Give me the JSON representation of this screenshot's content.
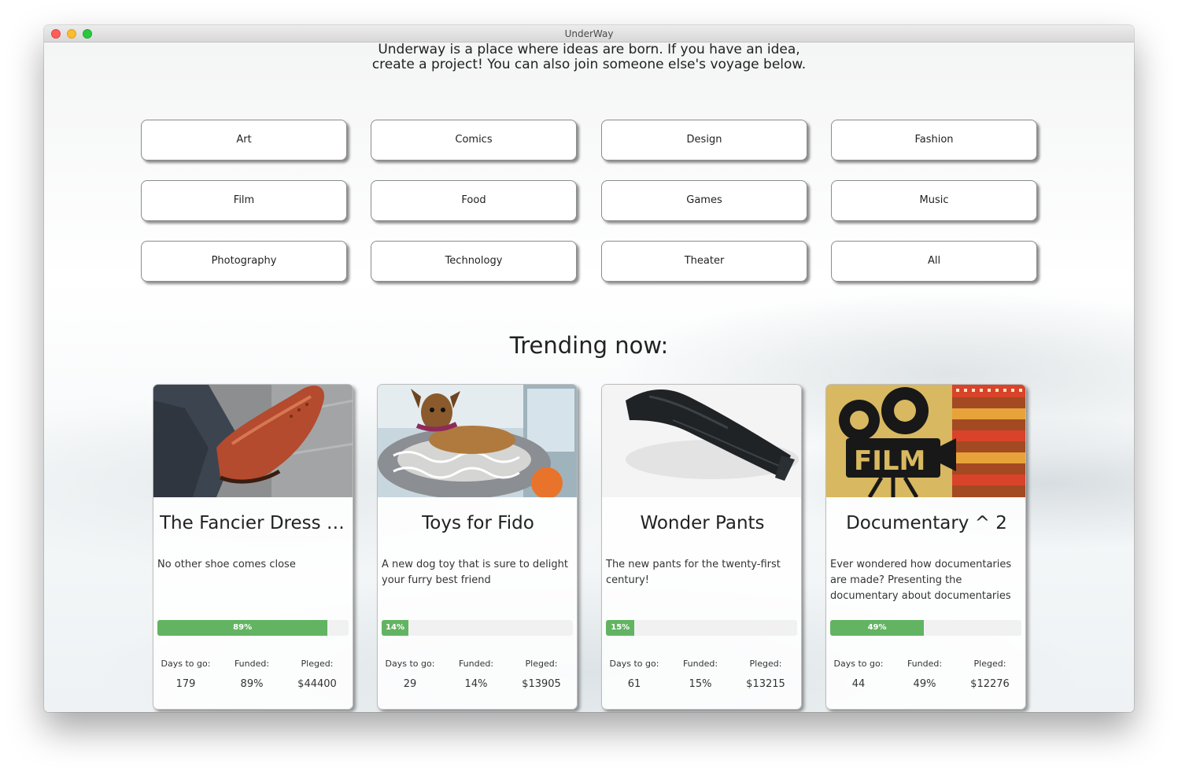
{
  "window": {
    "title": "UnderWay"
  },
  "intro": "Underway is a place where ideas are born. If you have an idea, create a project! You can also join someone else's voyage below.",
  "categories": [
    "Art",
    "Comics",
    "Design",
    "Fashion",
    "Film",
    "Food",
    "Games",
    "Music",
    "Photography",
    "Technology",
    "Theater",
    "All"
  ],
  "trending_heading": "Trending now:",
  "stat_labels": {
    "days": "Days to go:",
    "funded": "Funded:",
    "pledged": "Pleged:"
  },
  "projects": [
    {
      "title": "The Fancier Dress Sh...",
      "description": "No other shoe comes close",
      "progress_label": "89%",
      "progress": 0.89,
      "days": "179",
      "funded": "89%",
      "pledged": "$44400",
      "image": "dress-shoe-photo"
    },
    {
      "title": "Toys for Fido",
      "description": "A new dog toy that is sure to delight your furry best friend",
      "progress_label": "14%",
      "progress": 0.14,
      "days": "29",
      "funded": "14%",
      "pledged": "$13905",
      "image": "dog-with-toy-photo"
    },
    {
      "title": "Wonder Pants",
      "description": "The new pants for the twenty-first century!",
      "progress_label": "15%",
      "progress": 0.15,
      "days": "61",
      "funded": "15%",
      "pledged": "$13215",
      "image": "black-pants-photo"
    },
    {
      "title": "Documentary ^ 2",
      "description": "Ever wondered how documentaries are made? Presenting the documentary about documentaries",
      "progress_label": "49%",
      "progress": 0.49,
      "days": "44",
      "funded": "49%",
      "pledged": "$12276",
      "image": "film-camera-illustration"
    }
  ],
  "colors": {
    "progress": "#62b462",
    "window_close": "#fc5f57",
    "window_minimize": "#fdbc2e",
    "window_maximize": "#29c840"
  }
}
